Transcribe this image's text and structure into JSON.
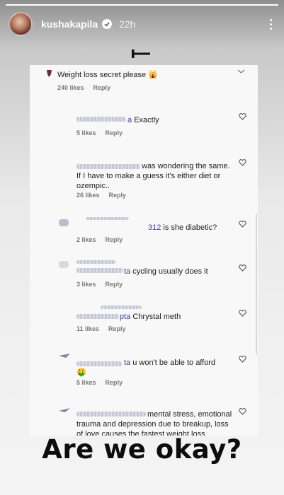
{
  "story": {
    "progress": 1.0,
    "username": "kushakapila",
    "time": "22h",
    "caption": "Are we okay?"
  },
  "icons": {
    "more": "more-vertical-icon",
    "verified": "verified-badge-icon",
    "heart": "heart-outline-icon",
    "collapse": "collapse-bar-icon"
  },
  "comments": [
    {
      "text": "Weight loss secret please 🙀",
      "likes": "240 likes",
      "reply": "Reply"
    },
    {
      "prefix": "a",
      "text": "Exactly",
      "likes": "5 likes",
      "reply": "Reply"
    },
    {
      "text": "was wondering the same.",
      "text2": "If I have to make a guess it's either diet or",
      "text3": "ozempic..",
      "likes": "26 likes",
      "reply": "Reply"
    },
    {
      "prefix": "312",
      "text": "is she diabetic?",
      "likes": "2 likes",
      "reply": "Reply"
    },
    {
      "prefix": "ta",
      "text": "cycling usually does it",
      "likes": "3 likes",
      "reply": "Reply"
    },
    {
      "prefix": "pta",
      "text": "Chrystal meth",
      "likes": "11 likes",
      "reply": "Reply"
    },
    {
      "prefix": "ta",
      "text": "u won't be able to afford",
      "text2": "🤑",
      "likes": "5 likes",
      "reply": "Reply"
    },
    {
      "text": "mental stress, emotional",
      "text2": "trauma and depression due to breakup, loss",
      "text3": "of love causes the fastest weight loss"
    }
  ]
}
